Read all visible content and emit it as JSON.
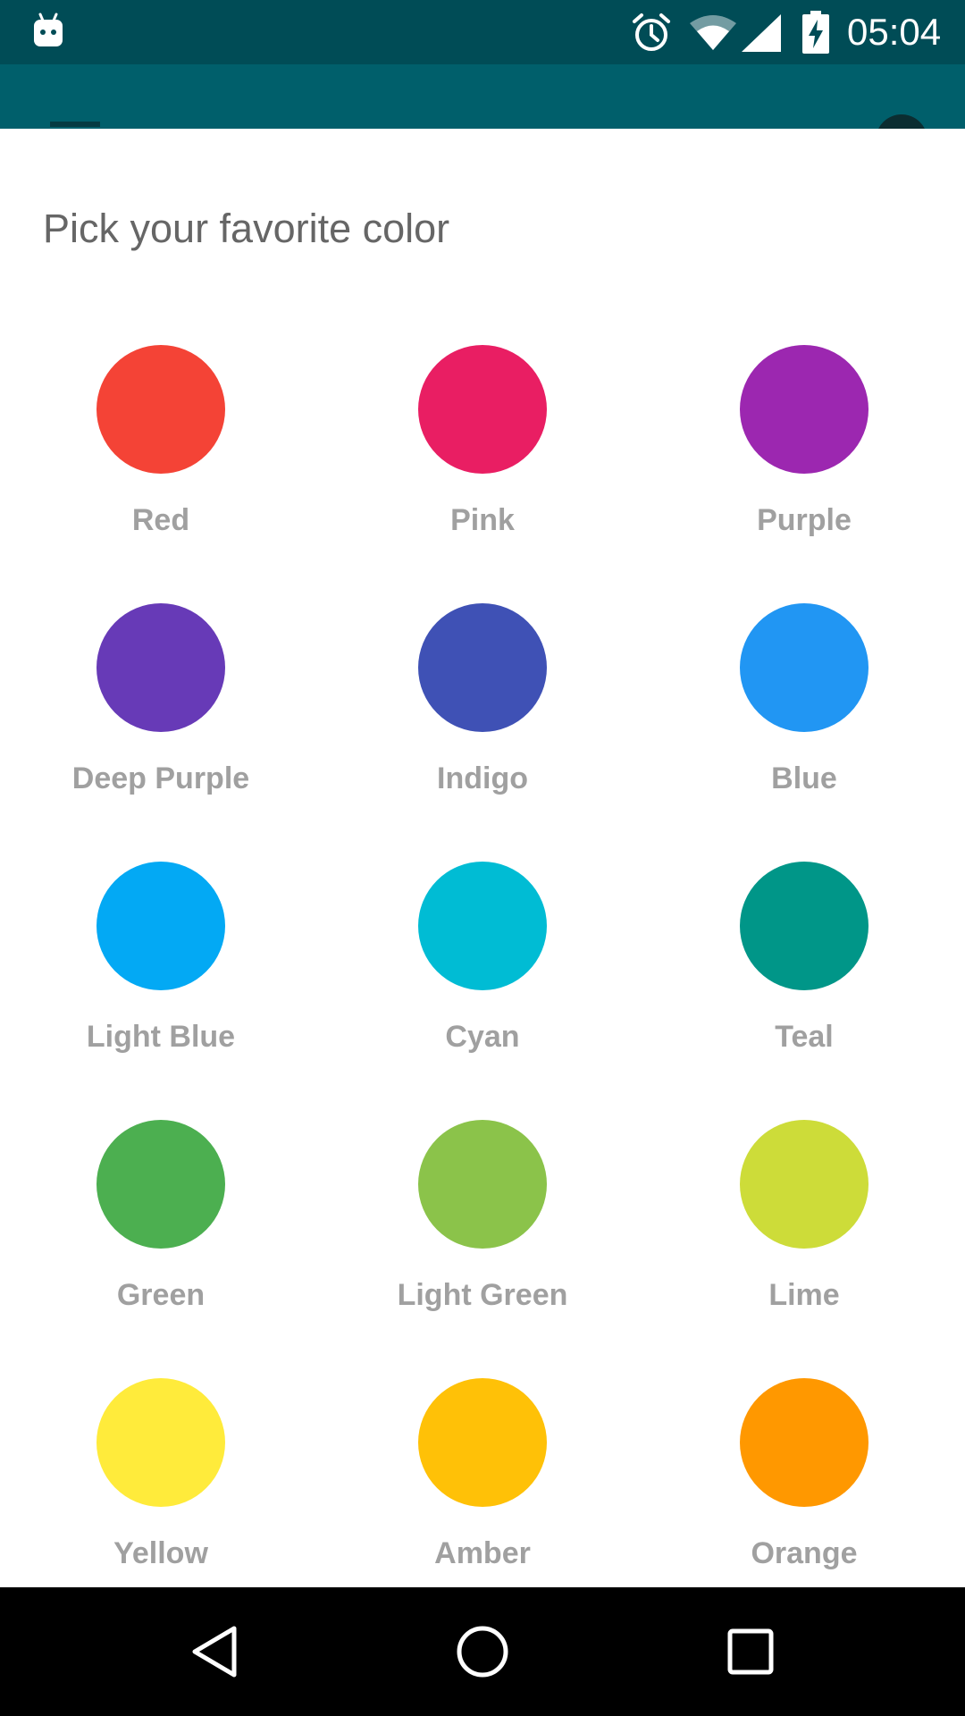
{
  "status_bar": {
    "time": "05:04",
    "icons": [
      "android-icon",
      "alarm-icon",
      "wifi-icon",
      "signal-icon",
      "battery-charging-icon"
    ]
  },
  "app_bar": {
    "background": "#005f6b",
    "icons": [
      "menu-icon",
      "account-icon"
    ]
  },
  "dialog": {
    "title": "Pick your favorite color",
    "colors": [
      {
        "label": "Red",
        "hex": "#f44336"
      },
      {
        "label": "Pink",
        "hex": "#e91e63"
      },
      {
        "label": "Purple",
        "hex": "#9c27b0"
      },
      {
        "label": "Deep Purple",
        "hex": "#673ab7"
      },
      {
        "label": "Indigo",
        "hex": "#3f51b5"
      },
      {
        "label": "Blue",
        "hex": "#2196f3"
      },
      {
        "label": "Light Blue",
        "hex": "#03a9f4"
      },
      {
        "label": "Cyan",
        "hex": "#00bcd4"
      },
      {
        "label": "Teal",
        "hex": "#009688"
      },
      {
        "label": "Green",
        "hex": "#4caf50"
      },
      {
        "label": "Light Green",
        "hex": "#8bc34a"
      },
      {
        "label": "Lime",
        "hex": "#cddc39"
      },
      {
        "label": "Yellow",
        "hex": "#ffeb3b"
      },
      {
        "label": "Amber",
        "hex": "#ffc107"
      },
      {
        "label": "Orange",
        "hex": "#ff9800"
      }
    ]
  },
  "nav_bar": {
    "buttons": [
      "back-icon",
      "home-icon",
      "recents-icon"
    ]
  }
}
